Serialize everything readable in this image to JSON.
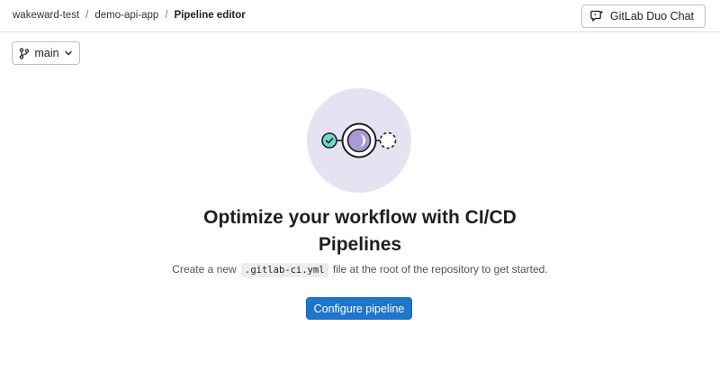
{
  "breadcrumb": {
    "items": [
      "wakeward-test",
      "demo-api-app"
    ],
    "separator": "/",
    "current": "Pipeline editor"
  },
  "header": {
    "duo_chat_label": "GitLab Duo Chat"
  },
  "branch_selector": {
    "selected": "main"
  },
  "empty_state": {
    "title": "Optimize your workflow with CI/CD Pipelines",
    "description_prefix": "Create a new",
    "file_name": ".gitlab-ci.yml",
    "description_suffix": "file at the root of the repository to get started.",
    "button_label": "Configure pipeline"
  },
  "colors": {
    "primary_button": "#1f75cb",
    "illustration_bg": "#e5e3f1",
    "success_green": "#6fdac8",
    "running_purple": "#a89ad6"
  },
  "icons": {
    "duo_chat": "duo-chat-icon",
    "branch": "branch-icon",
    "dropdown": "chevron-down-icon"
  }
}
